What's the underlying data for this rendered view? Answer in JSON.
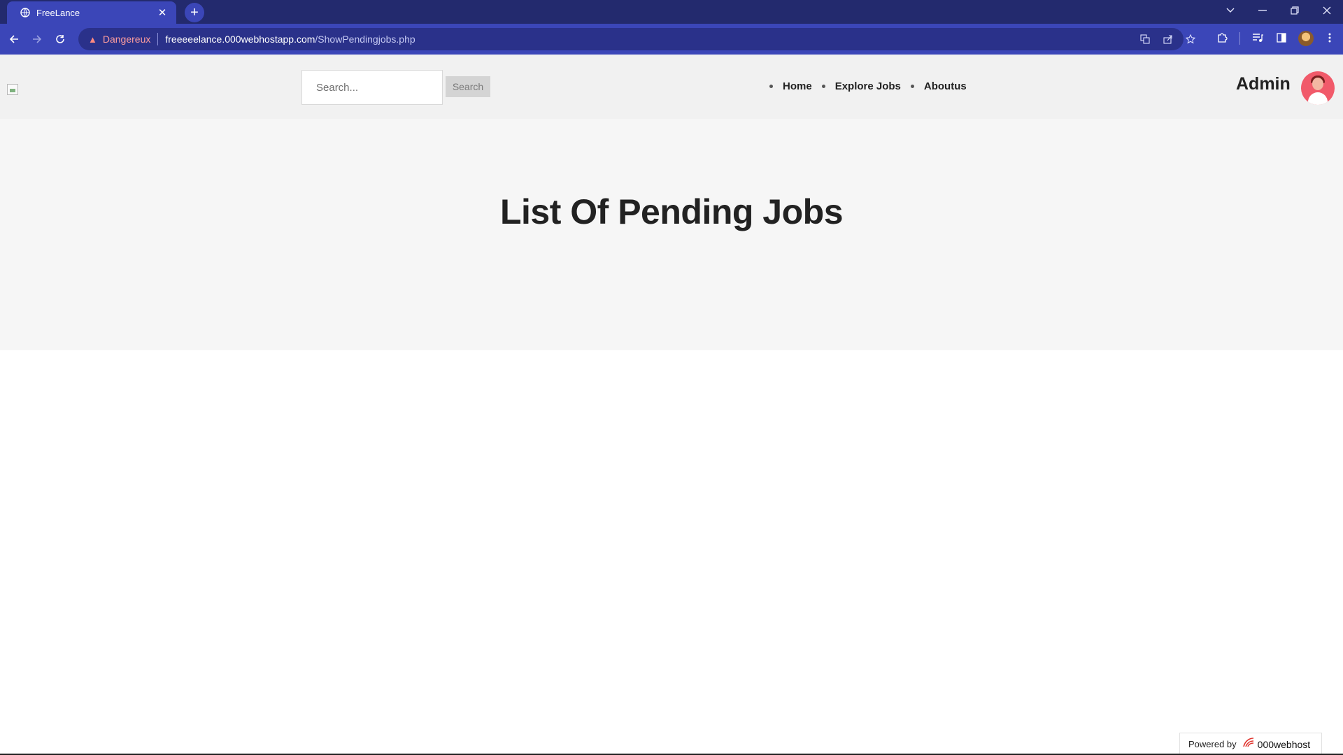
{
  "browser": {
    "tab_title": "FreeLance",
    "tab_close": "✕",
    "new_tab": "+",
    "security_label": "Dangereux",
    "url_domain": "freeeeelance.000webhostapp.com",
    "url_path": "/ShowPendingjobs.php",
    "icons": {
      "back": "back-arrow-icon",
      "forward": "forward-arrow-icon",
      "reload": "reload-icon",
      "warning": "warning-triangle-icon",
      "translate": "translate-icon",
      "share": "share-icon",
      "bookmark": "star-icon",
      "extensions": "puzzle-icon",
      "media": "media-queue-icon",
      "sidepanel": "side-panel-icon",
      "menu": "kebab-menu-icon"
    }
  },
  "header": {
    "search_placeholder": "Search...",
    "search_button": "Search",
    "nav": [
      {
        "label": "Home"
      },
      {
        "label": "Explore Jobs"
      },
      {
        "label": "Aboutus"
      }
    ],
    "user_name": "Admin"
  },
  "hero": {
    "title": "List Of Pending Jobs"
  },
  "footer_badge": {
    "powered_by": "Powered by",
    "brand": "000webhost"
  },
  "colors": {
    "chrome_dark": "#232a6e",
    "chrome_accent": "#3b46b8",
    "header_bg": "#f1f1f1",
    "hero_bg": "#f6f6f6",
    "avatar": "#f15a6a"
  }
}
